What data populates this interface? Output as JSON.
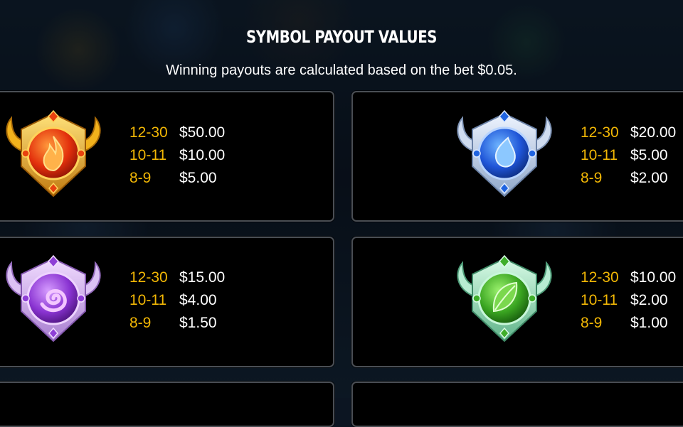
{
  "header": {
    "title": "SYMBOL PAYOUT VALUES",
    "subtitle": "Winning payouts are calculated based on the bet $0.05."
  },
  "symbols": [
    {
      "icon": "fire-symbol-icon",
      "color": "#e8410f",
      "rows": [
        {
          "range": "12-30",
          "amount": "$50.00"
        },
        {
          "range": "10-11",
          "amount": "$10.00"
        },
        {
          "range": "8-9",
          "amount": "$5.00"
        }
      ]
    },
    {
      "icon": "water-symbol-icon",
      "color": "#1f63e0",
      "rows": [
        {
          "range": "12-30",
          "amount": "$20.00"
        },
        {
          "range": "10-11",
          "amount": "$5.00"
        },
        {
          "range": "8-9",
          "amount": "$2.00"
        }
      ]
    },
    {
      "icon": "spiral-symbol-icon",
      "color": "#8e3fd6",
      "rows": [
        {
          "range": "12-30",
          "amount": "$15.00"
        },
        {
          "range": "10-11",
          "amount": "$4.00"
        },
        {
          "range": "8-9",
          "amount": "$1.50"
        }
      ]
    },
    {
      "icon": "leaf-symbol-icon",
      "color": "#3fae2a",
      "rows": [
        {
          "range": "12-30",
          "amount": "$10.00"
        },
        {
          "range": "10-11",
          "amount": "$2.00"
        },
        {
          "range": "8-9",
          "amount": "$1.00"
        }
      ]
    }
  ]
}
